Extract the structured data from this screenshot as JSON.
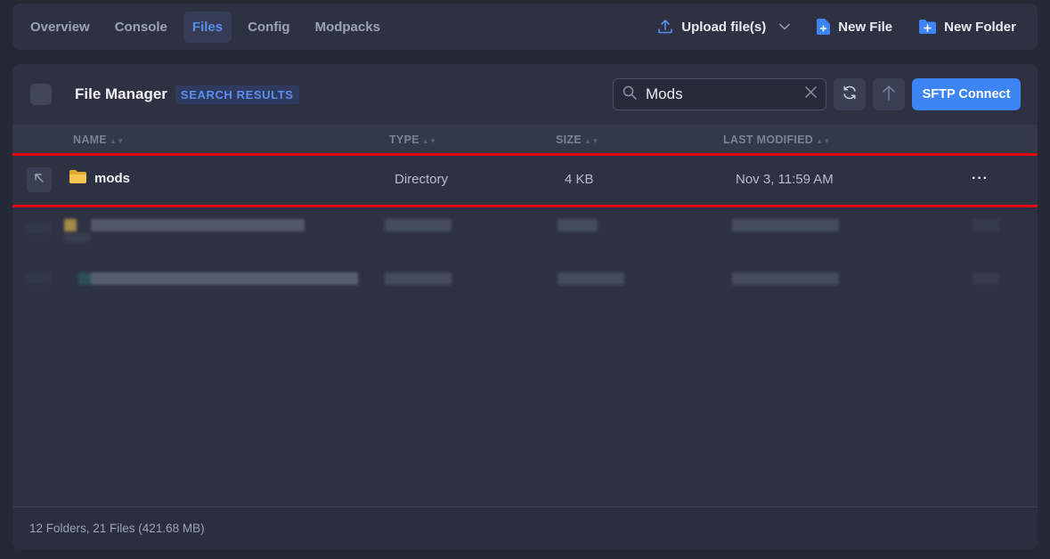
{
  "nav": {
    "tabs": [
      {
        "label": "Overview",
        "active": false
      },
      {
        "label": "Console",
        "active": false
      },
      {
        "label": "Files",
        "active": true
      },
      {
        "label": "Config",
        "active": false
      },
      {
        "label": "Modpacks",
        "active": false
      }
    ],
    "upload_label": "Upload file(s)",
    "new_file_label": "New File",
    "new_folder_label": "New Folder"
  },
  "file_manager": {
    "title": "File Manager",
    "badge": "SEARCH RESULTS",
    "search_value": "Mods",
    "sftp_label": "SFTP Connect",
    "columns": {
      "name": "NAME",
      "type": "TYPE",
      "size": "SIZE",
      "modified": "LAST MODIFIED"
    },
    "rows": [
      {
        "name": "mods",
        "type": "Directory",
        "size": "4 KB",
        "modified": "Nov 3, 11:59 AM",
        "icon": "folder-icon"
      }
    ],
    "footer": "12 Folders, 21 Files (421.68 MB)"
  },
  "colors": {
    "accent": "#3d84f5",
    "active_tab": "#5b8dee",
    "highlight": "#e30613",
    "folder": "#f0c14b"
  }
}
